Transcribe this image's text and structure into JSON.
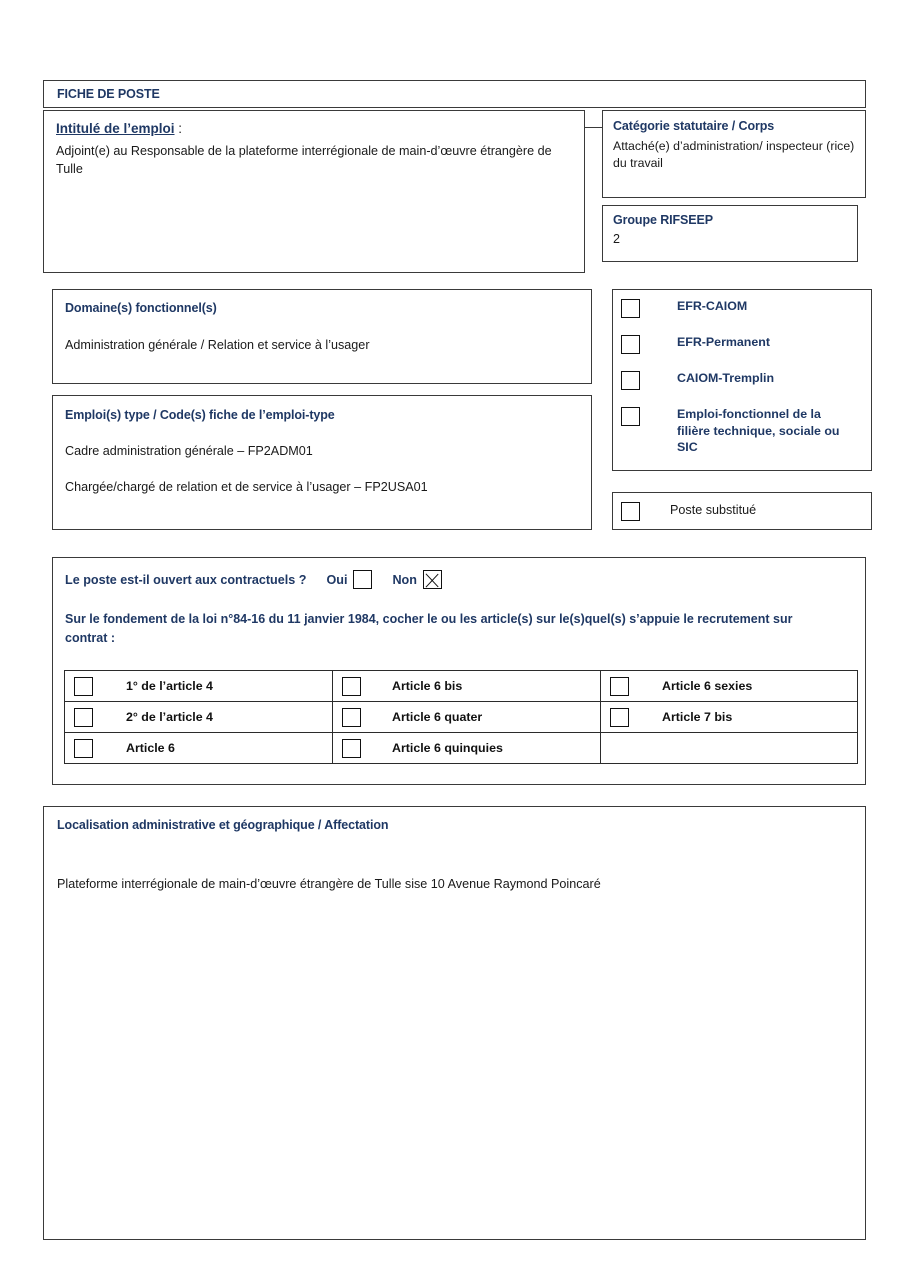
{
  "document": {
    "header_title": "FICHE DE POSTE"
  },
  "intitule": {
    "label": "Intitulé de l’emploi",
    "colon": " :",
    "value": "Adjoint(e) au Responsable de la plateforme interrégionale de main-d’œuvre étrangère de Tulle"
  },
  "categorie": {
    "label": "Catégorie statutaire / Corps",
    "value": " Attaché(e) d’administration/ inspecteur (rice) du travail"
  },
  "rifseep": {
    "label": "Groupe RIFSEEP",
    "value": "2"
  },
  "domaine": {
    "label": "Domaine(s) fonctionnel(s)",
    "value": "Administration générale / Relation et service à l’usager"
  },
  "emploi_type": {
    "label": "Emploi(s) type / Code(s) fiche de l’emploi-type",
    "line1": "Cadre administration générale – FP2ADM01",
    "line2": "Chargée/chargé de relation et de service à l’usager – FP2USA01"
  },
  "efr_options": [
    {
      "label": "EFR-CAIOM",
      "checked": false
    },
    {
      "label": "EFR-Permanent",
      "checked": false
    },
    {
      "label": "CAIOM-Tremplin",
      "checked": false
    },
    {
      "label": "Emploi-fonctionnel de la filière technique, sociale ou SIC",
      "checked": false
    }
  ],
  "poste_substitue": {
    "label": "Poste substitué",
    "checked": false
  },
  "contractuels": {
    "question": "Le poste est-il ouvert aux contractuels ?",
    "option_yes_label": "Oui",
    "option_yes_checked": false,
    "option_no_label": "Non",
    "option_no_checked": true,
    "note": "Sur le fondement de la loi n°84-16 du 11 janvier 1984, cocher le ou les article(s) sur le(s)quel(s) s’appuie le recrutement sur contrat :",
    "articles": [
      [
        {
          "label": "1° de l’article 4",
          "checked": false
        },
        {
          "label": "Article 6 bis",
          "checked": false
        },
        {
          "label": "Article 6 sexies",
          "checked": false
        }
      ],
      [
        {
          "label": "2° de l’article 4",
          "checked": false
        },
        {
          "label": "Article 6 quater",
          "checked": false
        },
        {
          "label": "Article 7 bis",
          "checked": false
        }
      ],
      [
        {
          "label": "Article 6",
          "checked": false
        },
        {
          "label": "Article 6 quinquies",
          "checked": false
        },
        {
          "label": "",
          "checked": null
        }
      ]
    ]
  },
  "localisation": {
    "label": "Localisation administrative et géographique / Affectation",
    "value": "Plateforme interrégionale de main-d’œuvre étrangère de Tulle sise 10 Avenue Raymond Poincaré"
  },
  "colors": {
    "heading_blue": "#1F3864",
    "border_gray": "#3a3a3a",
    "text_black": "#1a1a1a"
  }
}
